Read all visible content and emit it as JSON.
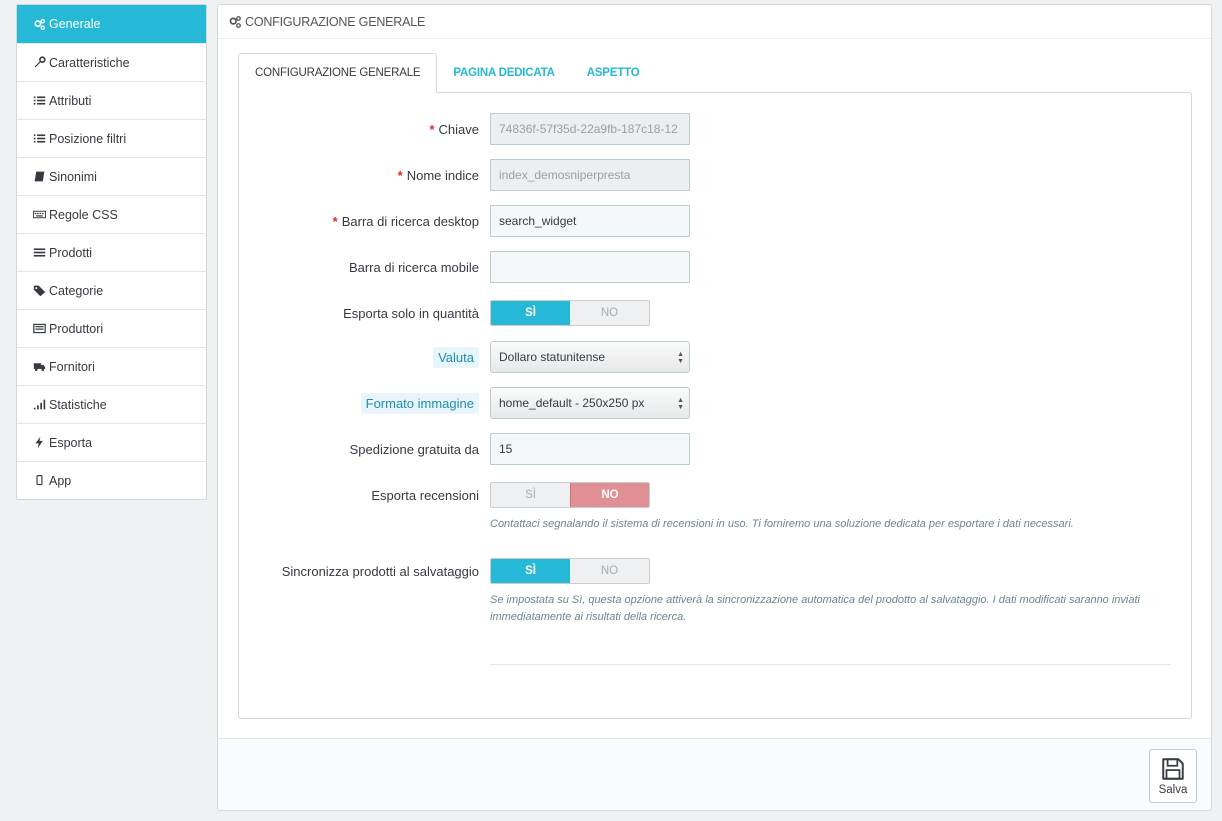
{
  "sidebar": {
    "items": [
      {
        "label": "Generale",
        "icon": "gears-icon"
      },
      {
        "label": "Caratteristiche",
        "icon": "wrench-icon"
      },
      {
        "label": "Attributi",
        "icon": "list-icon"
      },
      {
        "label": "Posizione filtri",
        "icon": "list-icon"
      },
      {
        "label": "Sinonimi",
        "icon": "book-icon"
      },
      {
        "label": "Regole CSS",
        "icon": "keyboard-icon"
      },
      {
        "label": "Prodotti",
        "icon": "list-alt-icon"
      },
      {
        "label": "Categorie",
        "icon": "tags-icon"
      },
      {
        "label": "Produttori",
        "icon": "building-icon"
      },
      {
        "label": "Fornitori",
        "icon": "truck-icon"
      },
      {
        "label": "Statistiche",
        "icon": "signal-icon"
      },
      {
        "label": "Esporta",
        "icon": "bolt-icon"
      },
      {
        "label": "App",
        "icon": "mobile-icon"
      }
    ]
  },
  "panel": {
    "title": "CONFIGURAZIONE GENERALE",
    "tabs": [
      "CONFIGURAZIONE GENERALE",
      "PAGINA DEDICATA",
      "ASPETTO"
    ]
  },
  "form": {
    "key": {
      "label": "Chiave",
      "value": "74836f-57f35d-22a9fb-187c18-12"
    },
    "index_name": {
      "label": "Nome indice",
      "value": "index_demosniperpresta"
    },
    "desktop_search": {
      "label": "Barra di ricerca desktop",
      "value": "search_widget"
    },
    "mobile_search": {
      "label": "Barra di ricerca mobile",
      "value": ""
    },
    "export_qty": {
      "label": "Esporta solo in quantità",
      "yes": "SÌ",
      "no": "NO"
    },
    "currency": {
      "label": "Valuta",
      "value": "Dollaro statunitense"
    },
    "image_format": {
      "label": "Formato immagine",
      "value": "home_default - 250x250 px"
    },
    "free_shipping": {
      "label": "Spedizione gratuita da",
      "value": "15"
    },
    "export_reviews": {
      "label": "Esporta recensioni",
      "yes": "SÌ",
      "no": "NO",
      "help": "Contattaci segnalando il sistema di recensioni in uso. Ti forniremo una soluzione dedicata per esportare i dati necessari."
    },
    "sync_products": {
      "label": "Sincronizza prodotti al salvataggio",
      "yes": "SÌ",
      "no": "NO",
      "help": "Se impostata su Sì, questa opzione attiverà la sincronizzazione automatica del prodotto al salvataggio. I dati modificati saranno inviati immediatamente ai risultati della ricerca."
    }
  },
  "footer": {
    "save_label": "Salva"
  },
  "colors": {
    "accent": "#25b9d7",
    "danger": "#e08f95",
    "required": "#e42a2a"
  }
}
